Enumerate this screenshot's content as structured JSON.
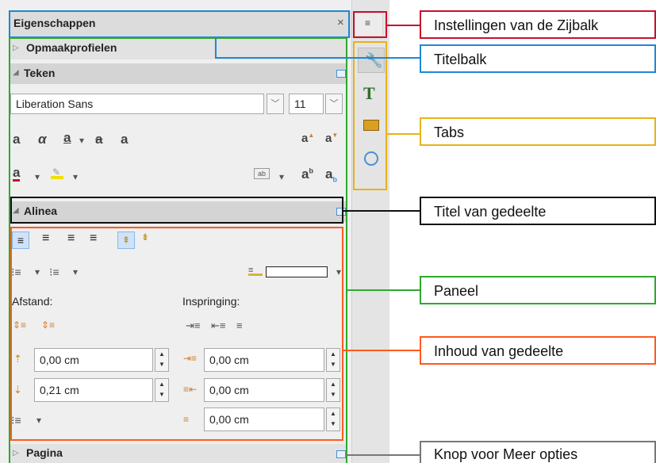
{
  "sidebar": {
    "title": "Eigenschappen",
    "close_icon": "×",
    "menu_icon": "≡",
    "sections": {
      "styles": "Opmaakprofielen",
      "character": "Teken",
      "paragraph": "Alinea",
      "page": "Pagina"
    },
    "font_name": "Liberation Sans",
    "font_size": "11",
    "char_glyphs": [
      "a",
      "α",
      "a",
      "·",
      "ⓐ",
      "a"
    ],
    "paragraph": {
      "spacing_label": "Afstand:",
      "indent_label": "Inspringing:",
      "above": "0,00 cm",
      "below": "0,21 cm",
      "indent_before": "0,00 cm",
      "indent_after": "0,00 cm",
      "first_line": "0,00 cm"
    }
  },
  "tabs": [
    {
      "icon": "wrench-icon"
    },
    {
      "icon": "styles-icon"
    },
    {
      "icon": "gallery-icon"
    },
    {
      "icon": "navigator-icon"
    }
  ],
  "annotations": {
    "settings": "Instellingen van de Zijbalk",
    "titlebar": "Titelbalk",
    "tabs": "Tabs",
    "deck_title": "Titel van gedeelte",
    "panel": "Paneel",
    "content": "Inhoud van gedeelte",
    "more_options": "Knop voor Meer opties"
  },
  "colors": {
    "red": "#c8102e",
    "blue": "#1e88d4",
    "yellow": "#e8b21a",
    "black": "#111111",
    "green": "#2daa2d",
    "orange": "#ff5a1f",
    "gray": "#777777"
  }
}
